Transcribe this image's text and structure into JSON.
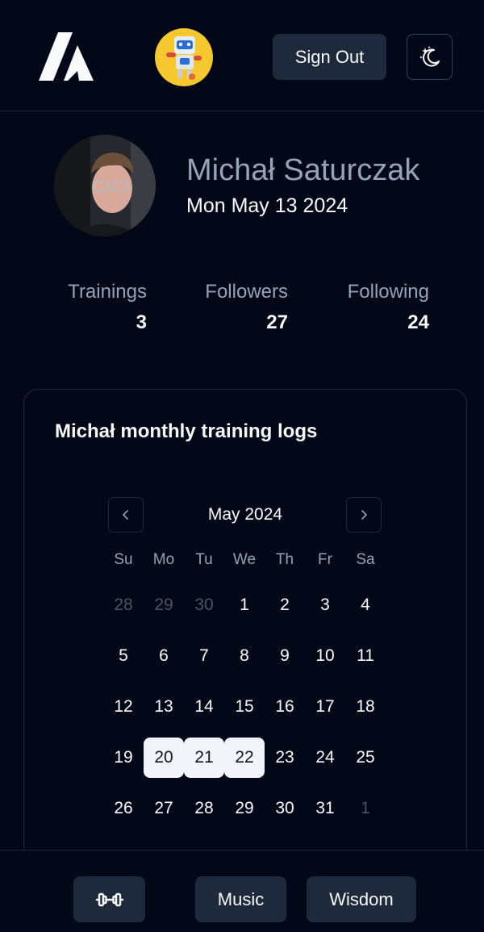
{
  "header": {
    "signout_label": "Sign Out"
  },
  "profile": {
    "name": "Michał Saturczak",
    "date": "Mon May 13 2024"
  },
  "stats": [
    {
      "label": "Trainings",
      "value": "3"
    },
    {
      "label": "Followers",
      "value": "27"
    },
    {
      "label": "Following",
      "value": "24"
    }
  ],
  "calendar": {
    "title": "Michał monthly training logs",
    "month": "May 2024",
    "weekdays": [
      "Su",
      "Mo",
      "Tu",
      "We",
      "Th",
      "Fr",
      "Sa"
    ],
    "weeks": [
      [
        {
          "d": "28",
          "outside": true
        },
        {
          "d": "29",
          "outside": true
        },
        {
          "d": "30",
          "outside": true
        },
        {
          "d": "1"
        },
        {
          "d": "2"
        },
        {
          "d": "3"
        },
        {
          "d": "4"
        }
      ],
      [
        {
          "d": "5"
        },
        {
          "d": "6"
        },
        {
          "d": "7"
        },
        {
          "d": "8"
        },
        {
          "d": "9"
        },
        {
          "d": "10"
        },
        {
          "d": "11"
        }
      ],
      [
        {
          "d": "12"
        },
        {
          "d": "13"
        },
        {
          "d": "14"
        },
        {
          "d": "15"
        },
        {
          "d": "16"
        },
        {
          "d": "17"
        },
        {
          "d": "18"
        }
      ],
      [
        {
          "d": "19"
        },
        {
          "d": "20",
          "selected": true
        },
        {
          "d": "21",
          "selected": true
        },
        {
          "d": "22",
          "selected": true
        },
        {
          "d": "23"
        },
        {
          "d": "24"
        },
        {
          "d": "25"
        }
      ],
      [
        {
          "d": "26"
        },
        {
          "d": "27"
        },
        {
          "d": "28"
        },
        {
          "d": "29"
        },
        {
          "d": "30"
        },
        {
          "d": "31"
        },
        {
          "d": "1",
          "outside": true
        }
      ]
    ]
  },
  "bottom_nav": {
    "training_icon": "dumbbell-icon",
    "music_label": "Music",
    "wisdom_label": "Wisdom"
  },
  "colors": {
    "background": "#020817",
    "muted": "#94a3b8",
    "secondary": "#1e293b",
    "selected": "#f1f5f9",
    "bot_avatar": "#f4c82e"
  }
}
